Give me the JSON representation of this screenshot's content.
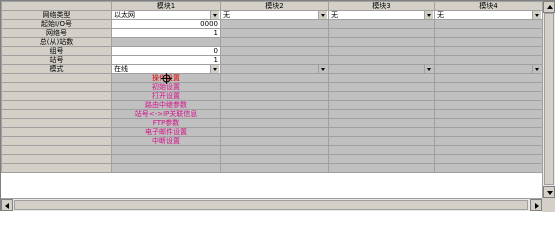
{
  "columns": [
    "",
    "模块1",
    "模块2",
    "模块3",
    "模块4"
  ],
  "rows": {
    "network_type": {
      "label": "网络类型",
      "m1": "以太网",
      "m2": "无",
      "m3": "无",
      "m4": "无"
    },
    "start_io": {
      "label": "起始I/O号",
      "m1": "0000"
    },
    "network_no": {
      "label": "网络号",
      "m1": "1"
    },
    "station_count": {
      "label": "总(从)站数"
    },
    "group_no": {
      "label": "组号",
      "m1": "0"
    },
    "station_no": {
      "label": "站号",
      "m1": "1"
    },
    "mode": {
      "label": "模式",
      "m1": "在线"
    }
  },
  "settings_links": [
    {
      "label": "操作设置",
      "color": "#e00000"
    },
    {
      "label": "初始设置",
      "color": "#d4108a"
    },
    {
      "label": "打开设置",
      "color": "#d4108a"
    },
    {
      "label": "路由中继参数",
      "color": "#d4108a"
    },
    {
      "label": "站号<->IP关联信息",
      "color": "#d4108a"
    },
    {
      "label": "FTP参数",
      "color": "#d4108a"
    },
    {
      "label": "电子邮件设置",
      "color": "#d4108a"
    },
    {
      "label": "中断设置",
      "color": "#d4108a"
    }
  ],
  "empty_rows": 3
}
